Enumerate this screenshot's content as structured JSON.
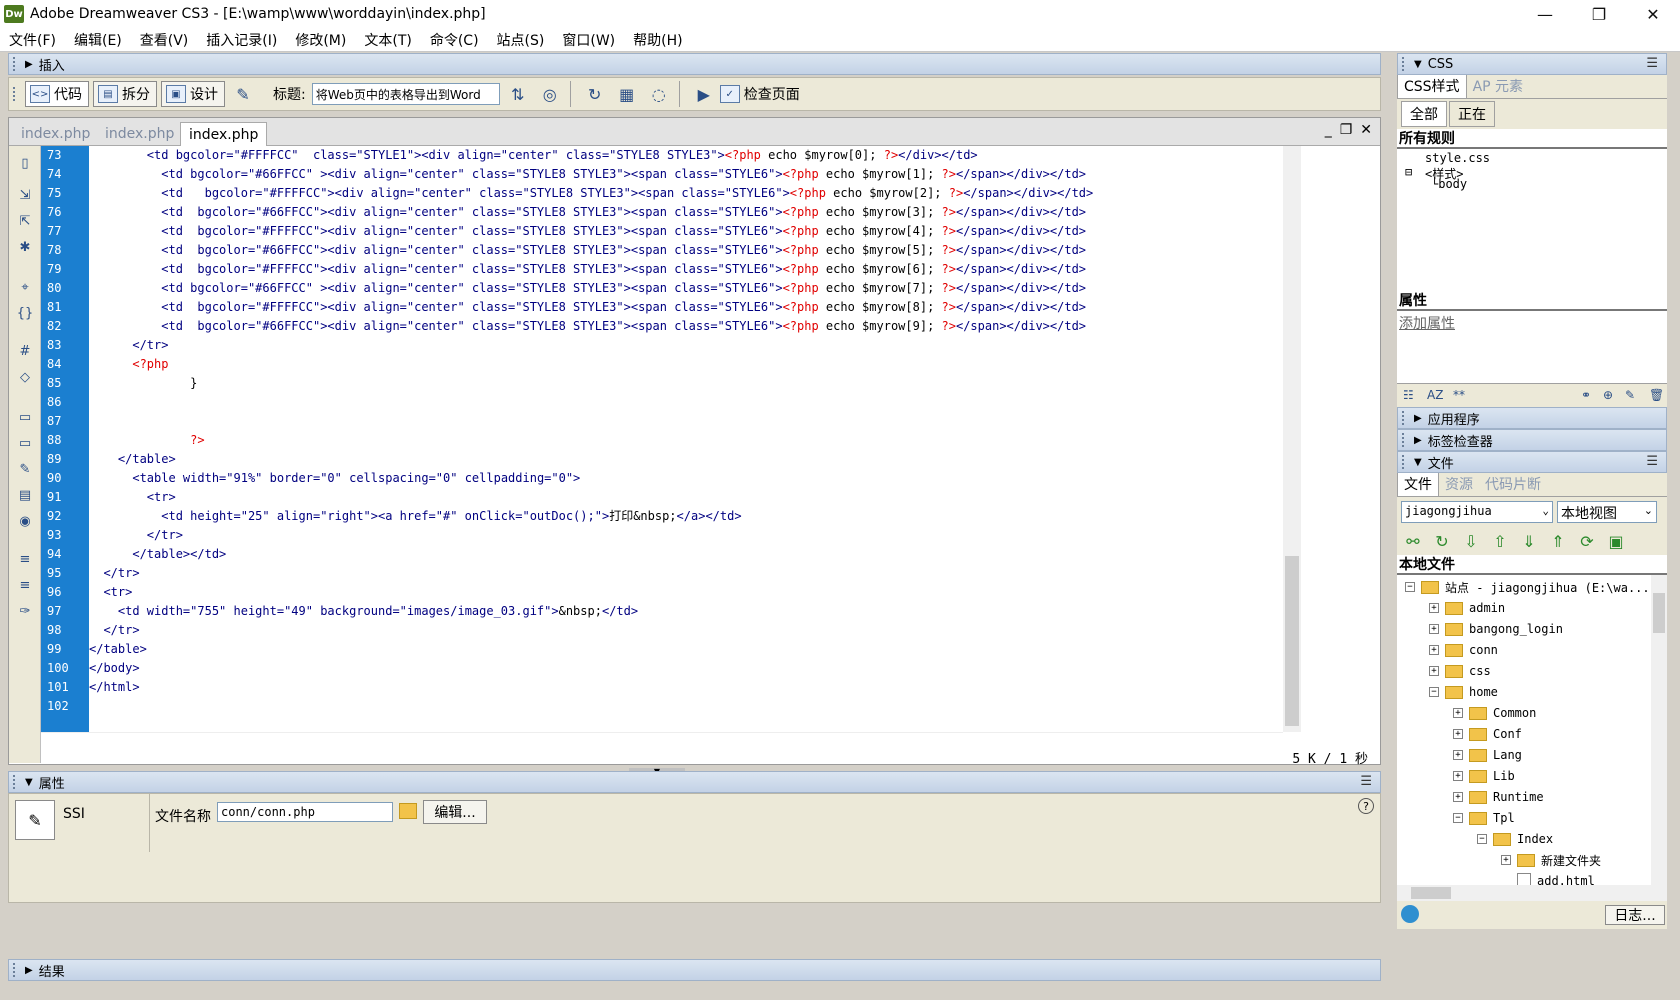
{
  "window": {
    "title": "Adobe Dreamweaver CS3 - [E:\\wamp\\www\\worddayin\\index.php]",
    "logo": "Dw",
    "controls": [
      "—",
      "❐",
      "✕"
    ]
  },
  "menu": [
    "文件(F)",
    "编辑(E)",
    "查看(V)",
    "插入记录(I)",
    "修改(M)",
    "文本(T)",
    "命令(C)",
    "站点(S)",
    "窗口(W)",
    "帮助(H)"
  ],
  "insert_bar": {
    "label": "插入"
  },
  "toolbar": {
    "code_label": "代码",
    "split_label": "拆分",
    "design_label": "设计",
    "title_label": "标题:",
    "title_value": "将Web页中的表格导出到Word",
    "check_page_label": "检查页面"
  },
  "document": {
    "tabs": [
      "index.php",
      "index.php",
      "index.php"
    ],
    "active_tab": 2,
    "status": "5 K / 1 秒",
    "line_numbers": [
      "73",
      "74",
      "75",
      "76",
      "77",
      "78",
      "79",
      "80",
      "81",
      "82",
      "83",
      "84",
      "85",
      "86",
      "87",
      "88",
      "89",
      "90",
      "91",
      "92",
      "93",
      "94",
      "95",
      "96",
      "97",
      "98",
      "99",
      "100",
      "101",
      "102"
    ],
    "lines": [
      {
        "indent": "        ",
        "html": "<td bgcolor=\"#FFFFCC\"  class=\"STYLE1\"><div align=\"center\" class=\"STYLE8 STYLE3\">",
        "php": "<?php",
        "code": " echo $myrow[0]; ",
        "end": "?>",
        "tail": "</div></td>"
      },
      {
        "indent": "          ",
        "html": "<td bgcolor=\"#66FFCC\" ><div align=\"center\" class=\"STYLE8 STYLE3\"><span class=\"STYLE6\">",
        "php": "<?php",
        "code": " echo $myrow[1]; ",
        "end": "?>",
        "tail": "</span></div></td>"
      },
      {
        "indent": "          ",
        "html": "<td   bgcolor=\"#FFFFCC\"><div align=\"center\" class=\"STYLE8 STYLE3\"><span class=\"STYLE6\">",
        "php": "<?php",
        "code": " echo $myrow[2]; ",
        "end": "?>",
        "tail": "</span></div></td>"
      },
      {
        "indent": "          ",
        "html": "<td  bgcolor=\"#66FFCC\"><div align=\"center\" class=\"STYLE8 STYLE3\"><span class=\"STYLE6\">",
        "php": "<?php",
        "code": " echo $myrow[3]; ",
        "end": "?>",
        "tail": "</span></div></td>"
      },
      {
        "indent": "          ",
        "html": "<td  bgcolor=\"#FFFFCC\"><div align=\"center\" class=\"STYLE8 STYLE3\"><span class=\"STYLE6\">",
        "php": "<?php",
        "code": " echo $myrow[4]; ",
        "end": "?>",
        "tail": "</span></div></td>"
      },
      {
        "indent": "          ",
        "html": "<td  bgcolor=\"#66FFCC\"><div align=\"center\" class=\"STYLE8 STYLE3\"><span class=\"STYLE6\">",
        "php": "<?php",
        "code": " echo $myrow[5]; ",
        "end": "?>",
        "tail": "</span></div></td>"
      },
      {
        "indent": "          ",
        "html": "<td  bgcolor=\"#FFFFCC\"><div align=\"center\" class=\"STYLE8 STYLE3\"><span class=\"STYLE6\">",
        "php": "<?php",
        "code": " echo $myrow[6]; ",
        "end": "?>",
        "tail": "</span></div></td>"
      },
      {
        "indent": "          ",
        "html": "<td bgcolor=\"#66FFCC\" ><div align=\"center\" class=\"STYLE8 STYLE3\"><span class=\"STYLE6\">",
        "php": "<?php",
        "code": " echo $myrow[7]; ",
        "end": "?>",
        "tail": "</span></div></td>"
      },
      {
        "indent": "          ",
        "html": "<td  bgcolor=\"#FFFFCC\"><div align=\"center\" class=\"STYLE8 STYLE3\"><span class=\"STYLE6\">",
        "php": "<?php",
        "code": " echo $myrow[8]; ",
        "end": "?>",
        "tail": "</span></div></td>"
      },
      {
        "indent": "          ",
        "html": "<td  bgcolor=\"#66FFCC\"><div align=\"center\" class=\"STYLE8 STYLE3\"><span class=\"STYLE6\">",
        "php": "<?php",
        "code": " echo $myrow[9]; ",
        "end": "?>",
        "tail": "</span></div></td>"
      },
      {
        "indent": "      ",
        "html": "</tr>"
      },
      {
        "indent": "      ",
        "php": "<?php"
      },
      {
        "indent": "              ",
        "code": "}"
      },
      {
        "indent": ""
      },
      {
        "indent": ""
      },
      {
        "indent": "              ",
        "end": "?>"
      },
      {
        "indent": "    ",
        "html": "</table>"
      },
      {
        "indent": "      ",
        "html": "<table width=\"91%\" border=\"0\" cellspacing=\"0\" cellpadding=\"0\">"
      },
      {
        "indent": "        ",
        "html": "<tr>"
      },
      {
        "indent": "          ",
        "html": "<td height=\"25\" align=\"right\"><a href=\"#\" onClick=\"outDoc();\">",
        "code": "打印&nbsp;",
        "tail": "</a></td>"
      },
      {
        "indent": "        ",
        "html": "</tr>"
      },
      {
        "indent": "      ",
        "html": "</table></td>"
      },
      {
        "indent": "  ",
        "html": "</tr>"
      },
      {
        "indent": "  ",
        "html": "<tr>"
      },
      {
        "indent": "    ",
        "html": "<td width=\"755\" height=\"49\" background=\"images/image_03.gif\">",
        "code": "&nbsp;",
        "tail": "</td>"
      },
      {
        "indent": "  ",
        "html": "</tr>"
      },
      {
        "indent": "",
        "html": "</table>"
      },
      {
        "indent": "",
        "html": "</body>"
      },
      {
        "indent": "",
        "html": "</html>"
      },
      {
        "indent": ""
      }
    ]
  },
  "properties": {
    "header": "属性",
    "type_label": "SSI",
    "filename_label": "文件名称",
    "filename_value": "conn/conn.php",
    "edit_label": "编辑...",
    "help": "?"
  },
  "results": {
    "label": "结果"
  },
  "css_panel": {
    "header": "CSS",
    "tabs": [
      "CSS样式",
      "AP 元素"
    ],
    "mode_buttons": [
      "全部",
      "正在"
    ],
    "all_rules_title": "所有规则",
    "rules": [
      "style.css",
      "<样式>",
      "body"
    ],
    "props_title": "属性",
    "add_prop": "添加属性"
  },
  "app_panel": {
    "label": "应用程序"
  },
  "tag_panel": {
    "label": "标签检查器"
  },
  "files_panel": {
    "header": "文件",
    "tabs": [
      "文件",
      "资源",
      "代码片断"
    ],
    "site_select": "jiagongjihua",
    "view_select": "本地视图",
    "local_files_title": "本地文件",
    "tree": [
      {
        "label": "站点 - jiagongjihua (E:\\wa...",
        "level": 0,
        "exp": "−",
        "type": "folder"
      },
      {
        "label": "admin",
        "level": 1,
        "exp": "+",
        "type": "folder"
      },
      {
        "label": "bangong_login",
        "level": 1,
        "exp": "+",
        "type": "folder"
      },
      {
        "label": "conn",
        "level": 1,
        "exp": "+",
        "type": "folder"
      },
      {
        "label": "css",
        "level": 1,
        "exp": "+",
        "type": "folder"
      },
      {
        "label": "home",
        "level": 1,
        "exp": "−",
        "type": "folder"
      },
      {
        "label": "Common",
        "level": 2,
        "exp": "+",
        "type": "folder"
      },
      {
        "label": "Conf",
        "level": 2,
        "exp": "+",
        "type": "folder"
      },
      {
        "label": "Lang",
        "level": 2,
        "exp": "+",
        "type": "folder"
      },
      {
        "label": "Lib",
        "level": 2,
        "exp": "+",
        "type": "folder"
      },
      {
        "label": "Runtime",
        "level": 2,
        "exp": "+",
        "type": "folder"
      },
      {
        "label": "Tpl",
        "level": 2,
        "exp": "−",
        "type": "folder"
      },
      {
        "label": "Index",
        "level": 3,
        "exp": "−",
        "type": "folder"
      },
      {
        "label": "新建文件夹",
        "level": 4,
        "exp": "+",
        "type": "folder"
      },
      {
        "label": "add.html",
        "level": 4,
        "exp": "",
        "type": "file"
      }
    ],
    "log_label": "日志..."
  }
}
